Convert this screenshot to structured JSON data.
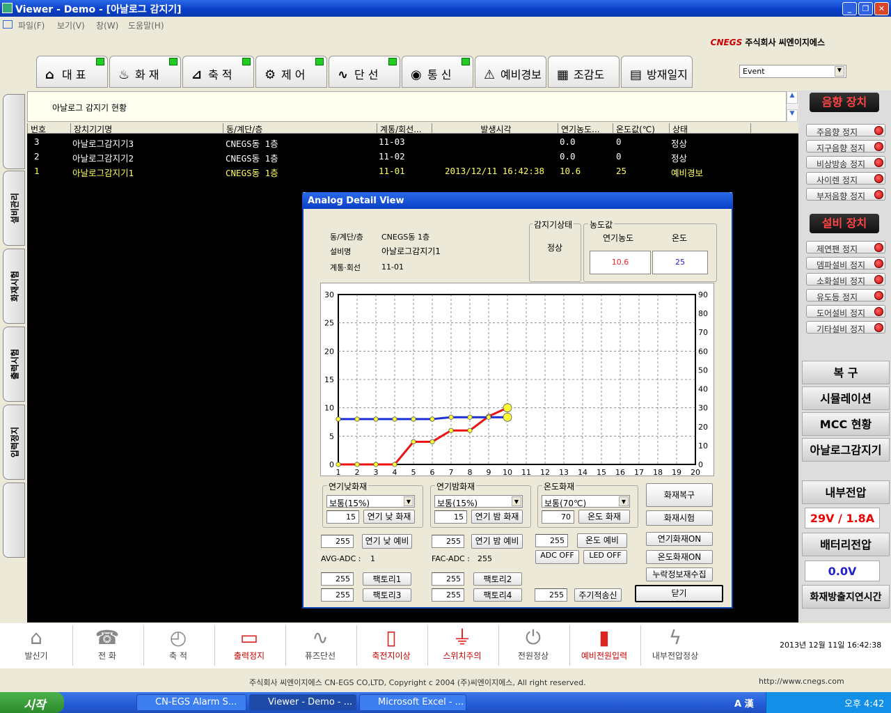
{
  "window": {
    "title": "Viewer - Demo - [아날로그 감지기]"
  },
  "menu": [
    "파일(F)",
    "보기(V)",
    "창(W)",
    "도움말(H)"
  ],
  "company": {
    "logo": "CNEGS",
    "name": "주식회사 씨엔이지에스"
  },
  "tabs": [
    {
      "label": "대 표",
      "icon": "home-icon",
      "glyph": "⌂"
    },
    {
      "label": "화 재",
      "icon": "fire-icon",
      "glyph": "♨"
    },
    {
      "label": "축 적",
      "icon": "accumulate-icon",
      "glyph": "⊿"
    },
    {
      "label": "제 어",
      "icon": "gear-icon",
      "glyph": "⚙"
    },
    {
      "label": "단 선",
      "icon": "pulse-icon",
      "glyph": "∿"
    },
    {
      "label": "통 신",
      "icon": "antenna-icon",
      "glyph": "◉"
    },
    {
      "label": "예비경보",
      "icon": "siren-icon",
      "glyph": "⚠"
    },
    {
      "label": "조감도",
      "icon": "building-icon",
      "glyph": "▦"
    },
    {
      "label": "방재일지",
      "icon": "log-icon",
      "glyph": "▤"
    }
  ],
  "event_select": "Event",
  "left_tabs": [
    "",
    "설비관리",
    "화재시험",
    "출력시험",
    "입력정지",
    ""
  ],
  "panel_title": "아날로그 감지기 현황",
  "grid": {
    "headers": [
      "번호",
      "장치기기명",
      "동/계단/층",
      "계통/회선...",
      "발생시각",
      "연기농도...",
      "온도값(℃)",
      "상태"
    ],
    "rows": [
      {
        "no": "3",
        "name": "아날로그감지기3",
        "loc": "CNEGS동 1층",
        "line": "11-03",
        "time": "",
        "smoke": "0.0",
        "temp": "0",
        "state": "정상"
      },
      {
        "no": "2",
        "name": "아날로그감지기2",
        "loc": "CNEGS동 1층",
        "line": "11-02",
        "time": "",
        "smoke": "0.0",
        "temp": "0",
        "state": "정상"
      },
      {
        "no": "1",
        "name": "아날로그감지기1",
        "loc": "CNEGS동 1층",
        "line": "11-01",
        "time": "2013/12/11 16:42:38",
        "smoke": "10.6",
        "temp": "25",
        "state": "예비경보"
      }
    ]
  },
  "dialog": {
    "title": "Analog Detail View",
    "loc_label": "동/계단/층",
    "loc_value": "CNEGS동 1층",
    "name_label": "설비명",
    "name_value": "아날로그감지기1",
    "line_label": "계통·회선",
    "line_value": "11-01",
    "status_group": "감지기상태",
    "status_value": "정상",
    "conc_group": "농도값",
    "smoke_label": "연기농도",
    "temp_label": "온도",
    "smoke_value": "10.6",
    "temp_value": "25",
    "day_group": "연기낮화재",
    "day_select": "보통(15%)",
    "day_input": "15",
    "day_button": "연기 낮 화재",
    "night_group": "연기밤화재",
    "night_select": "보통(15%)",
    "night_input": "15",
    "night_button": "연기 밤 화재",
    "temp_group": "온도화재",
    "temp_select": "보통(70℃)",
    "temp_input": "70",
    "temp_button": "온도 화재",
    "fire_restore": "화재복구",
    "fire_test": "화재시험",
    "smoke_fire_on": "연기화재ON",
    "temp_fire_on": "온도화재ON",
    "collect": "누락정보재수집",
    "pre_day_input": "255",
    "pre_day_button": "연기 낮 예비",
    "pre_night_input": "255",
    "pre_night_button": "연기 밤 예비",
    "pre_temp_input": "255",
    "pre_temp_button": "온도 예비",
    "avg_adc_label": "AVG-ADC :",
    "avg_adc_value": "1",
    "fac_adc_label": "FAC-ADC :",
    "fac_adc_value": "255",
    "adc_off": "ADC OFF",
    "led_off": "LED OFF",
    "f1_input": "255",
    "f1": "팩토리1",
    "f2_input": "255",
    "f2": "팩토리2",
    "f3_input": "255",
    "f3": "팩토리3",
    "f4_input": "255",
    "f4": "팩토리4",
    "period_input": "255",
    "period": "주기적송신",
    "close": "닫기"
  },
  "chart_data": {
    "type": "line",
    "x": [
      1,
      2,
      3,
      4,
      5,
      6,
      7,
      8,
      9,
      10
    ],
    "x_ticks": [
      "1",
      "2",
      "3",
      "4",
      "5",
      "6",
      "7",
      "8",
      "9",
      "10",
      "11",
      "12",
      "13",
      "14",
      "15",
      "16",
      "17",
      "18",
      "19",
      "20"
    ],
    "xlim": [
      1,
      20
    ],
    "y_left_ticks": [
      "0",
      "5",
      "10",
      "15",
      "20",
      "25",
      "30"
    ],
    "ylim_left": [
      0,
      30
    ],
    "y_right_ticks": [
      "0",
      "10",
      "20",
      "30",
      "40",
      "50",
      "60",
      "70",
      "80",
      "90"
    ],
    "ylim_right": [
      0,
      90
    ],
    "grid": true,
    "series": [
      {
        "axis": "left",
        "color": "#ee1111",
        "values": [
          0,
          0,
          0,
          0,
          4,
          4,
          6,
          6,
          8.5,
          10
        ]
      },
      {
        "axis": "right",
        "color": "#1b2fd8",
        "values": [
          24,
          24,
          24,
          24,
          24,
          24,
          25,
          25,
          25,
          25
        ]
      }
    ]
  },
  "right": {
    "sound_head": "음향 장치",
    "sound": [
      "주음향 정지",
      "지구음향 정지",
      "비상방송 정지",
      "사이렌 정지",
      "부저음향 정지"
    ],
    "equip_head": "설비 장치",
    "equip": [
      "제연팬 정지",
      "뎀파설비 정지",
      "소화설비 정지",
      "유도등 정지",
      "도어설비 정지",
      "기타설비 정지"
    ],
    "restore": "복 구",
    "simulation": "시뮬레이션",
    "mcc": "MCC 현황",
    "analog": "아날로그감지기",
    "internal_label": "내부전압",
    "internal_value": "29V / 1.8A",
    "battery_label": "배터리전압",
    "battery_value": "0.0V",
    "delay_label": "화재방출지연시간"
  },
  "bottom": [
    {
      "label": "발신기",
      "icon": "transmitter-icon",
      "glyph": "⌂",
      "red": false
    },
    {
      "label": "전 화",
      "icon": "phone-icon",
      "glyph": "☎",
      "red": false
    },
    {
      "label": "축 적",
      "icon": "clock-icon",
      "glyph": "◴",
      "red": false
    },
    {
      "label": "출력정지",
      "icon": "monitor-stop-icon",
      "glyph": "▭",
      "red": true
    },
    {
      "label": "퓨즈단선",
      "icon": "fuse-icon",
      "glyph": "∿",
      "red": false
    },
    {
      "label": "축전지이상",
      "icon": "battery-alert-icon",
      "glyph": "▯",
      "red": true
    },
    {
      "label": "스위치주의",
      "icon": "switch-icon",
      "glyph": "⏚",
      "red": true
    },
    {
      "label": "전원정상",
      "icon": "power-icon",
      "glyph": "⏻",
      "red": false
    },
    {
      "label": "예비전원입력",
      "icon": "battery-icon",
      "glyph": "▮",
      "red": true
    },
    {
      "label": "내부전압정상",
      "icon": "volt-icon",
      "glyph": "ϟ",
      "red": false
    }
  ],
  "clock": "2013년 12월 11일 16:42:38",
  "footer": {
    "copyright": "주식회사 씨엔이지에스 CN-EGS CO,LTD, Copyright c 2004 (주)씨엔이지에스, All right reserved.",
    "url": "http://www.cnegs.com"
  },
  "taskbar": {
    "start": "시작",
    "tasks": [
      "CN-EGS Alarm S...",
      "Viewer - Demo - ...",
      "Microsoft Excel - ..."
    ],
    "lang": "A 漢",
    "time": "오후 4:42"
  }
}
